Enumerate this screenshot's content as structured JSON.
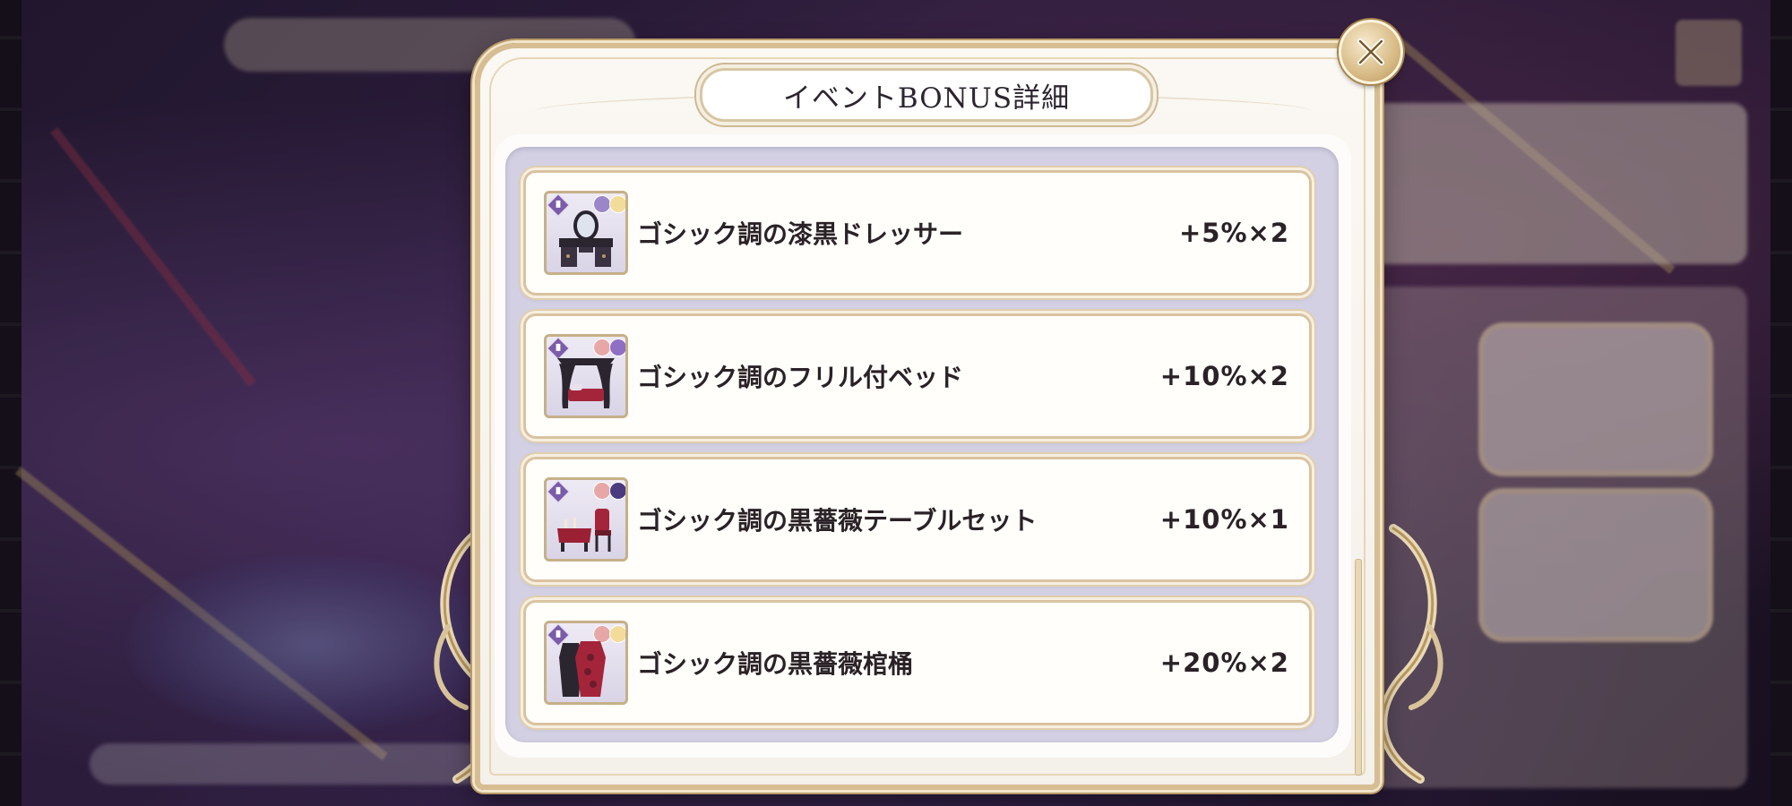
{
  "dialog": {
    "title": "イベントBONUS詳細",
    "close_icon": "close-icon"
  },
  "bonus_items": [
    {
      "name": "ゴシック調の漆黒ドレッサー",
      "bonus": "+5%×2",
      "icon": "dresser-icon"
    },
    {
      "name": "ゴシック調のフリル付ベッド",
      "bonus": "+10%×2",
      "icon": "bed-icon"
    },
    {
      "name": "ゴシック調の黒薔薇テーブルセット",
      "bonus": "+10%×1",
      "icon": "table-set-icon"
    },
    {
      "name": "ゴシック調の黒薔薇棺桶",
      "bonus": "+20%×2",
      "icon": "coffin-icon"
    }
  ],
  "colors": {
    "panel_gold": "#d6bd92",
    "list_bg": "#d2d0e2",
    "text_dark": "#2a2226",
    "rank_purple": "#7a5ca8"
  }
}
